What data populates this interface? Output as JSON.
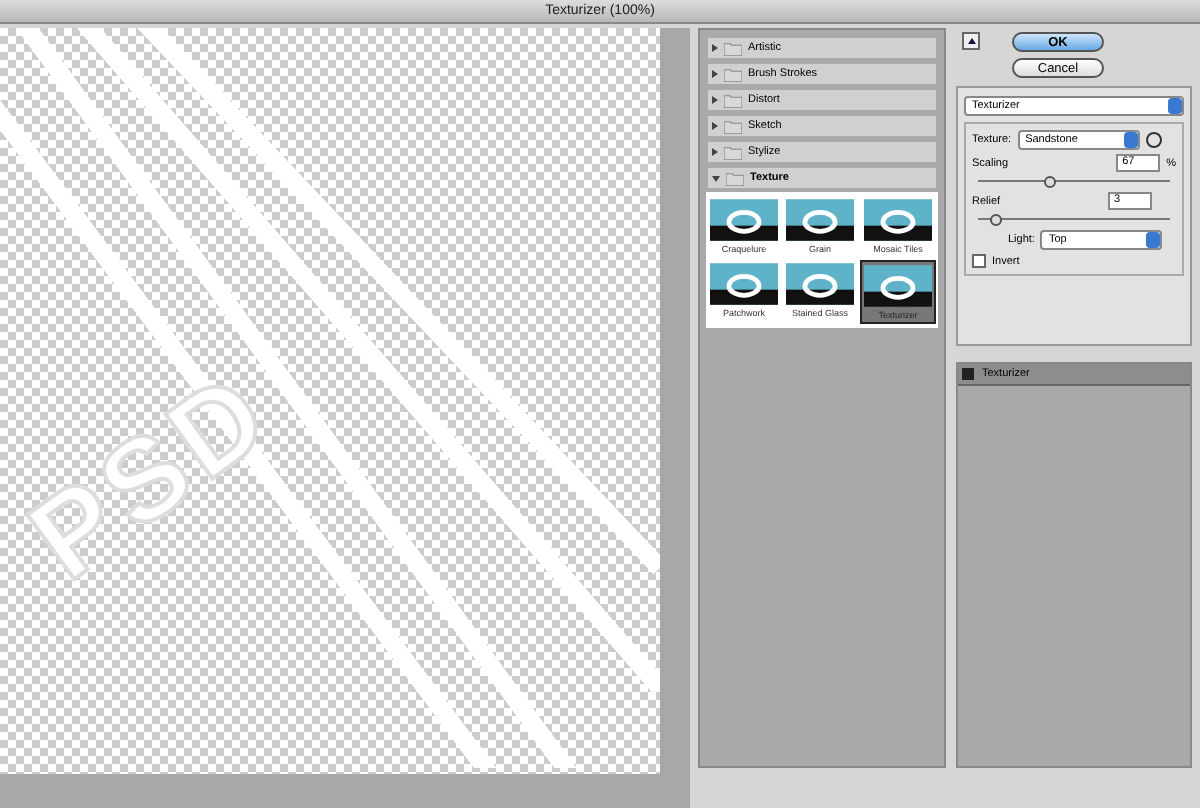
{
  "window": {
    "title": "Texturizer (100%)"
  },
  "canvas": {
    "text": "PSD"
  },
  "gallery": {
    "categories": [
      {
        "label": "Artistic",
        "expanded": false
      },
      {
        "label": "Brush Strokes",
        "expanded": false
      },
      {
        "label": "Distort",
        "expanded": false
      },
      {
        "label": "Sketch",
        "expanded": false
      },
      {
        "label": "Stylize",
        "expanded": false
      },
      {
        "label": "Texture",
        "expanded": true,
        "filters": [
          {
            "label": "Craquelure",
            "selected": false
          },
          {
            "label": "Grain",
            "selected": false
          },
          {
            "label": "Mosaic Tiles",
            "selected": false
          },
          {
            "label": "Patchwork",
            "selected": false
          },
          {
            "label": "Stained Glass",
            "selected": false
          },
          {
            "label": "Texturizer",
            "selected": true
          }
        ]
      }
    ]
  },
  "buttons": [
    {
      "label": "OK",
      "kind": "default"
    },
    {
      "label": "Cancel",
      "kind": "normal"
    }
  ],
  "settings": {
    "filter": "Texturizer",
    "texture_label": "Texture:",
    "texture": "Sandstone",
    "scaling": {
      "label": "Scaling",
      "value": "67",
      "unit": "%",
      "level": 0.34
    },
    "relief": {
      "label": "Relief",
      "value": "3",
      "level": 0.06
    },
    "light_label": "Light:",
    "light": "Top",
    "invert": {
      "label": "Invert",
      "checked": false
    }
  },
  "layers": [
    {
      "label": "Texturizer",
      "visible": true
    }
  ]
}
